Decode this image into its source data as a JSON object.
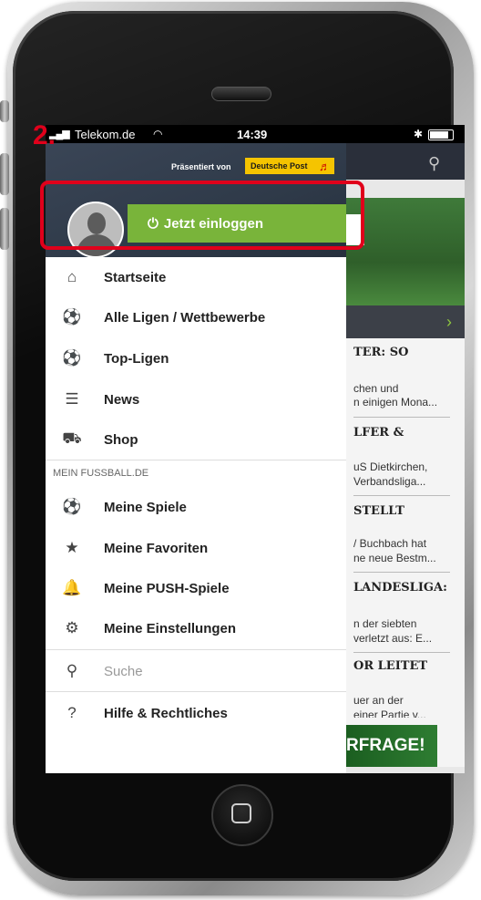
{
  "status_bar": {
    "carrier": "Telekom.de",
    "time": "14:39"
  },
  "annotation": {
    "step": "2.",
    "highlight_color": "#e0001b"
  },
  "drawer": {
    "presented_by": "Präsentiert von",
    "sponsor": "Deutsche Post",
    "login_label": "Jetzt einloggen",
    "menu": [
      {
        "label": "Startseite",
        "icon": "home-icon"
      },
      {
        "label": "Alle Ligen / Wettbewerbe",
        "icon": "ball-kick-icon"
      },
      {
        "label": "Top-Ligen",
        "icon": "ball-kick-icon"
      },
      {
        "label": "News",
        "icon": "news-icon"
      },
      {
        "label": "Shop",
        "icon": "cart-icon"
      }
    ],
    "section_title": "MEIN FUSSBALL.DE",
    "my_menu": [
      {
        "label": "Meine Spiele",
        "icon": "football-icon"
      },
      {
        "label": "Meine Favoriten",
        "icon": "star-icon"
      },
      {
        "label": "Meine PUSH-Spiele",
        "icon": "bell-icon"
      },
      {
        "label": "Meine Einstellungen",
        "icon": "gear-icon"
      }
    ],
    "search_label": "Suche",
    "help_label": "Hilfe & Rechtliches"
  },
  "background": {
    "items": [
      {
        "heading": "TER: SO",
        "lines": [
          "chen und",
          "n einigen Mona..."
        ]
      },
      {
        "heading": "LFER &",
        "lines": [
          "uS Dietkirchen,",
          "Verbandsliga..."
        ]
      },
      {
        "heading": "STELLT",
        "lines": [
          "/ Buchbach hat",
          "ne neue Bestm..."
        ]
      },
      {
        "heading": "LANDESLIGA:",
        "lines": [
          "n der siebten",
          "verletzt aus: E..."
        ]
      },
      {
        "heading": "OR LEITET",
        "lines": [
          "uer an der",
          "einer Partie v..."
        ]
      }
    ],
    "banner": "RFRAGE!"
  },
  "colors": {
    "accent_green": "#79b43a",
    "header_dark": "#2f3a49",
    "sponsor_yellow": "#f5c400"
  }
}
